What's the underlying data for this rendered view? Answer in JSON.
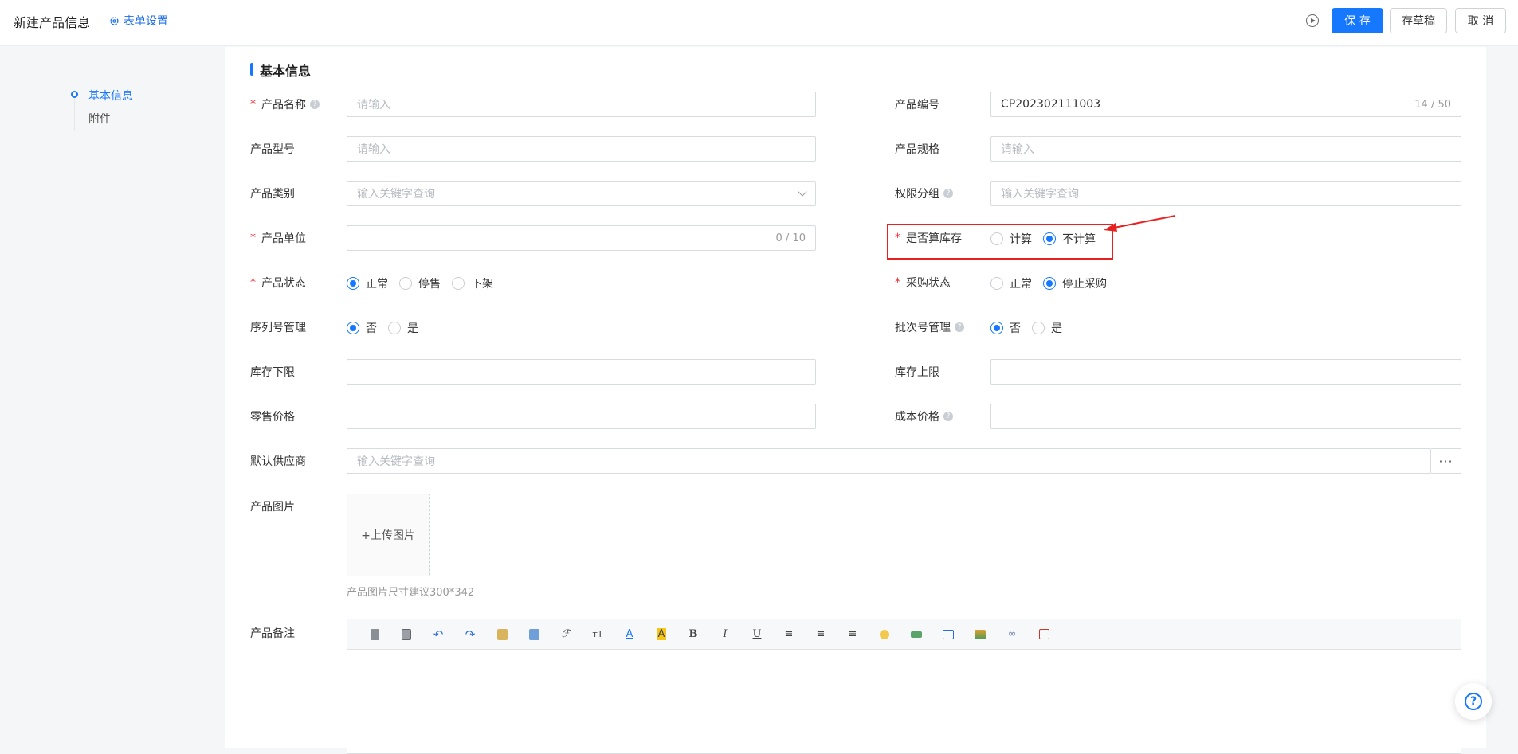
{
  "header": {
    "title": "新建产品信息",
    "form_settings": "表单设置",
    "save": "保 存",
    "draft": "存草稿",
    "cancel": "取 消"
  },
  "anchors": [
    "基本信息",
    "附件"
  ],
  "section_title": "基本信息",
  "fields": {
    "product_name": {
      "label": "产品名称",
      "placeholder": "请输入"
    },
    "product_code": {
      "label": "产品编号",
      "value": "CP202302111003",
      "count": "14 / 50"
    },
    "product_model": {
      "label": "产品型号",
      "placeholder": "请输入"
    },
    "product_spec": {
      "label": "产品规格",
      "placeholder": "请输入"
    },
    "product_category": {
      "label": "产品类别",
      "placeholder": "输入关键字查询"
    },
    "permission_group": {
      "label": "权限分组",
      "placeholder": "输入关键字查询"
    },
    "product_unit": {
      "label": "产品单位",
      "count": "0 / 10"
    },
    "calc_stock": {
      "label": "是否算库存",
      "options": [
        "计算",
        "不计算"
      ],
      "selected": "不计算"
    },
    "product_status": {
      "label": "产品状态",
      "options": [
        "正常",
        "停售",
        "下架"
      ],
      "selected": "正常"
    },
    "purchase_status": {
      "label": "采购状态",
      "options": [
        "正常",
        "停止采购"
      ],
      "selected": "停止采购"
    },
    "serial_mgmt": {
      "label": "序列号管理",
      "options": [
        "否",
        "是"
      ],
      "selected": "否"
    },
    "batch_mgmt": {
      "label": "批次号管理",
      "options": [
        "否",
        "是"
      ],
      "selected": "否"
    },
    "stock_min": {
      "label": "库存下限"
    },
    "stock_max": {
      "label": "库存上限"
    },
    "retail_price": {
      "label": "零售价格"
    },
    "cost_price": {
      "label": "成本价格"
    },
    "supplier": {
      "label": "默认供应商",
      "placeholder": "输入关键字查询",
      "more": "···"
    },
    "product_image": {
      "label": "产品图片",
      "upload": "+上传图片",
      "hint": "产品图片尺寸建议300*342"
    },
    "product_remark": {
      "label": "产品备注"
    }
  },
  "help_fab": "?"
}
